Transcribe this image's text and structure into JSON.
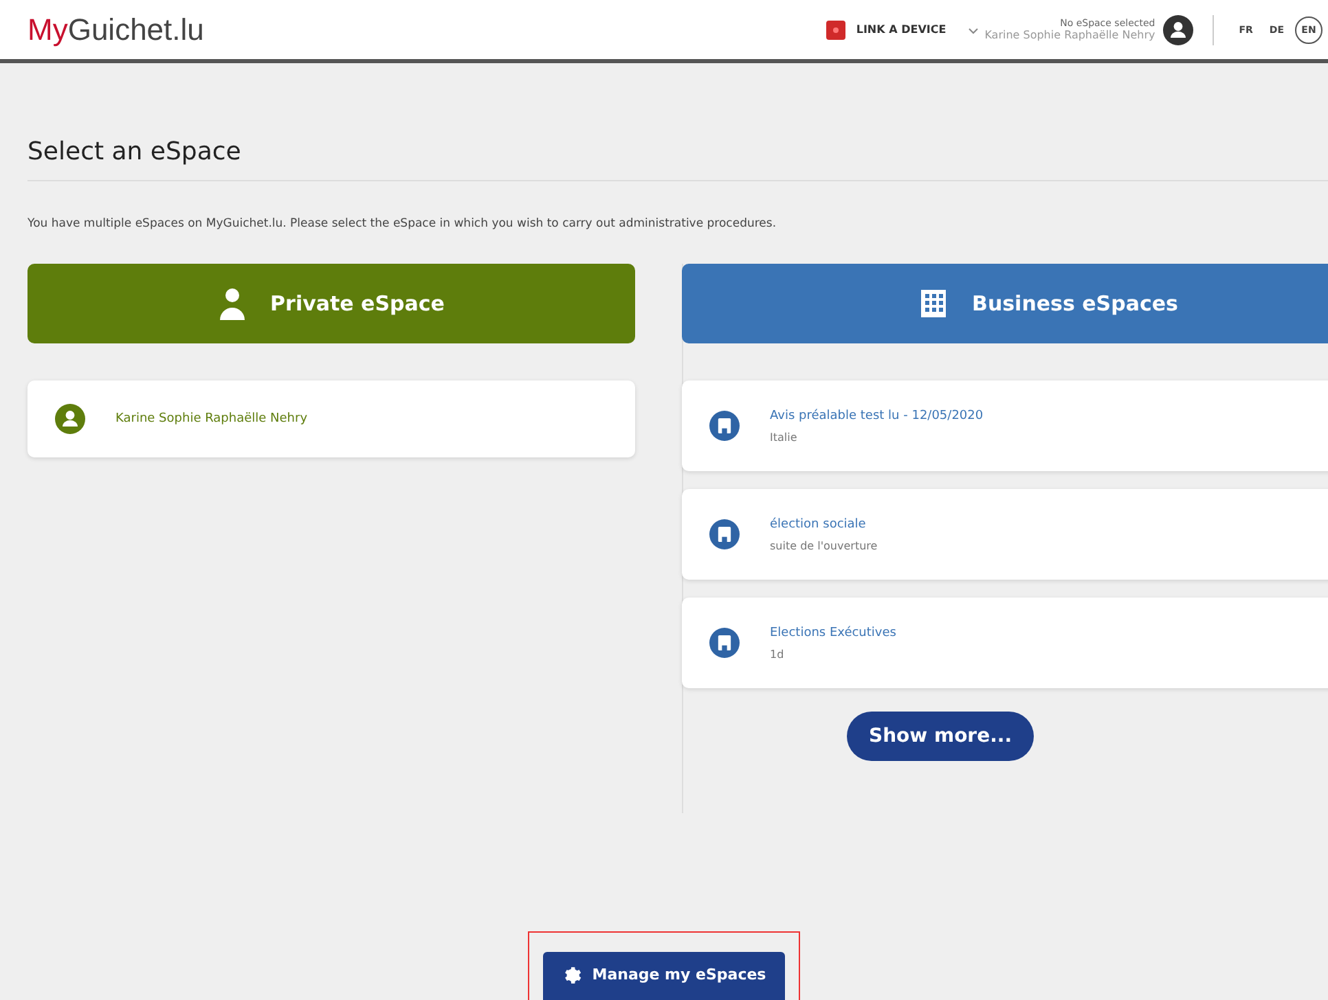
{
  "header": {
    "logo_prefix": "My",
    "logo_suffix": "Guichet.lu",
    "link_device": "LINK A DEVICE",
    "espace_status": "No eSpace selected",
    "user_name": "Karine Sophie Raphaëlle Nehry",
    "languages": [
      {
        "label": "FR",
        "selected": false
      },
      {
        "label": "DE",
        "selected": false
      },
      {
        "label": "EN",
        "selected": true
      }
    ]
  },
  "page": {
    "title": "Select an eSpace",
    "intro": "You have multiple eSpaces on MyGuichet.lu. Please select the eSpace in which you wish to carry out administrative procedures."
  },
  "private": {
    "heading": "Private eSpace",
    "items": [
      {
        "name": "Karine Sophie Raphaëlle Nehry"
      }
    ]
  },
  "business": {
    "heading": "Business eSpaces",
    "items": [
      {
        "name": "Avis préalable test lu - 12/05/2020",
        "detail": "Italie"
      },
      {
        "name": "élection sociale",
        "detail": "suite de l'ouverture"
      },
      {
        "name": "Elections Exécutives",
        "detail": "1d"
      }
    ],
    "show_more": "Show more..."
  },
  "manage_button": "Manage my eSpaces"
}
